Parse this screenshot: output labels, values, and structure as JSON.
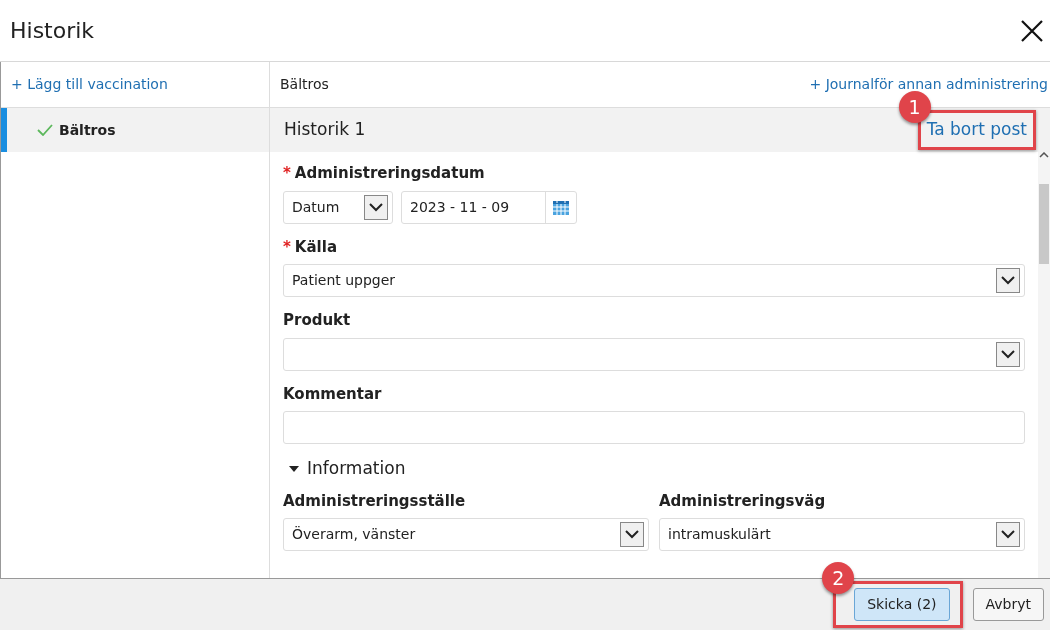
{
  "window": {
    "title": "Historik"
  },
  "sidebar": {
    "add_link": "+ Lägg till vaccination",
    "items": [
      {
        "label": "Bältros",
        "checked": true,
        "selected": true
      }
    ]
  },
  "main": {
    "title": "Bältros",
    "action_link": "+ Journalför annan administrering",
    "record": {
      "title": "Historik 1",
      "delete_link": "Ta bort post",
      "delete_callout": "1"
    },
    "fields": [
      {
        "kind": "date",
        "label": "Administreringsdatum",
        "required_mark": "*",
        "type_value": "Datum",
        "value": "2023 - 11 - 09"
      },
      {
        "kind": "select",
        "label": "Källa",
        "required_mark": "*",
        "value": "Patient uppger"
      },
      {
        "kind": "select",
        "label": "Produkt"
      },
      {
        "kind": "text",
        "label": "Kommentar"
      }
    ],
    "section": {
      "title": "Information",
      "expanded": true,
      "fields": [
        {
          "kind": "select",
          "label": "Administreringsställe",
          "value": "Överarm, vänster"
        },
        {
          "kind": "select",
          "label": "Administreringsväg",
          "value": "intramuskulärt"
        }
      ]
    }
  },
  "footer": {
    "buttons": [
      {
        "label": "Skicka (2)",
        "kind": "primary",
        "callout": "2"
      },
      {
        "label": "Avbryt",
        "kind": "secondary"
      }
    ]
  }
}
